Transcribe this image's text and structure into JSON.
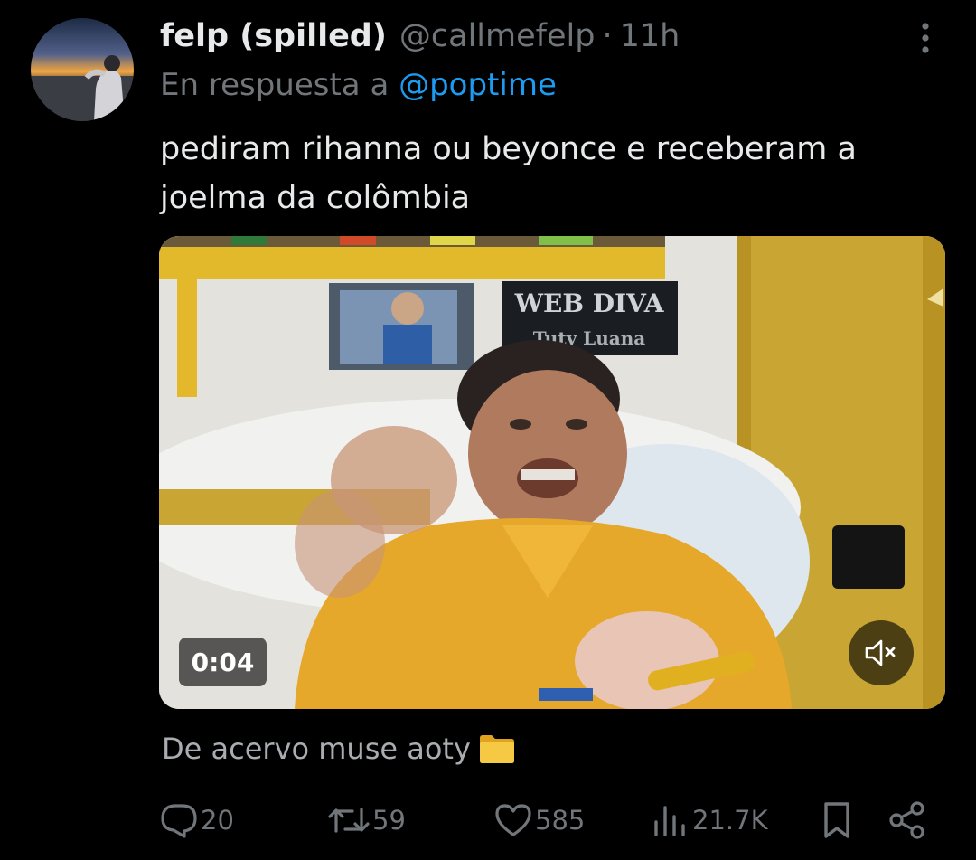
{
  "tweet": {
    "author": {
      "display_name": "felp (spilled)",
      "handle": "@callmefelp",
      "separator": "·",
      "time": "11h"
    },
    "reply_prefix": "En respuesta a",
    "reply_to": "@poptime",
    "text": "pediram rihanna ou beyonce e receberam a joelma da colômbia",
    "video": {
      "duration": "0:04",
      "sign_line1": "WEB DIVA",
      "sign_line2": "Tuty Luana",
      "muted": true
    },
    "caption": "De acervo muse aoty",
    "stats": {
      "replies": "20",
      "reposts": "59",
      "likes": "585",
      "views": "21.7K"
    }
  },
  "colors": {
    "background": "#000000",
    "primary_text": "#e7e9ea",
    "secondary_text": "#71767b",
    "link": "#1d9bf0"
  },
  "icons": {
    "more": "more-vertical-icon",
    "mute": "speaker-muted-icon",
    "folder": "folder-emoji",
    "reply": "reply-icon",
    "repost": "repost-icon",
    "like": "heart-icon",
    "views": "views-chart-icon",
    "bookmark": "bookmark-icon",
    "share": "share-icon"
  }
}
